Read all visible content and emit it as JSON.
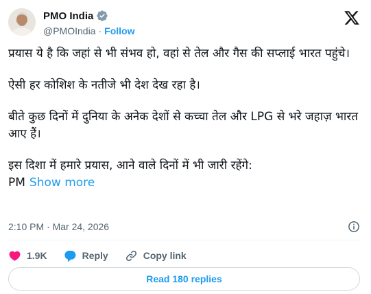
{
  "author": {
    "display_name": "PMO India",
    "handle": "@PMOIndia",
    "separator": "·",
    "follow_label": "Follow",
    "verified_color": "#829aab"
  },
  "tweet": {
    "paragraphs": [
      "प्रयास ये है कि जहां से भी संभव हो, वहां से तेल और गैस की सप्लाई भारत पहुंचे।",
      "ऐसी हर कोशिश के नतीजे भी देश देख रहा है।",
      "बीते कुछ दिनों में दुनिया के अनेक देशों से कच्चा तेल और LPG से भरे जहाज़ भारत आए हैं।",
      "इस दिशा में हमारे प्रयास, आने वाले दिनों में भी जारी रहेंगे:"
    ],
    "truncated_tail": "PM",
    "show_more_label": "Show more",
    "timestamp": "2:10 PM · Mar 24, 2026"
  },
  "actions": {
    "like_count": "1.9K",
    "reply_label": "Reply",
    "copy_link_label": "Copy link"
  },
  "read_replies_label": "Read 180 replies",
  "colors": {
    "accent": "#1d9bf0",
    "like": "#f91880",
    "reply": "#1d9bf0",
    "muted": "#536471"
  }
}
